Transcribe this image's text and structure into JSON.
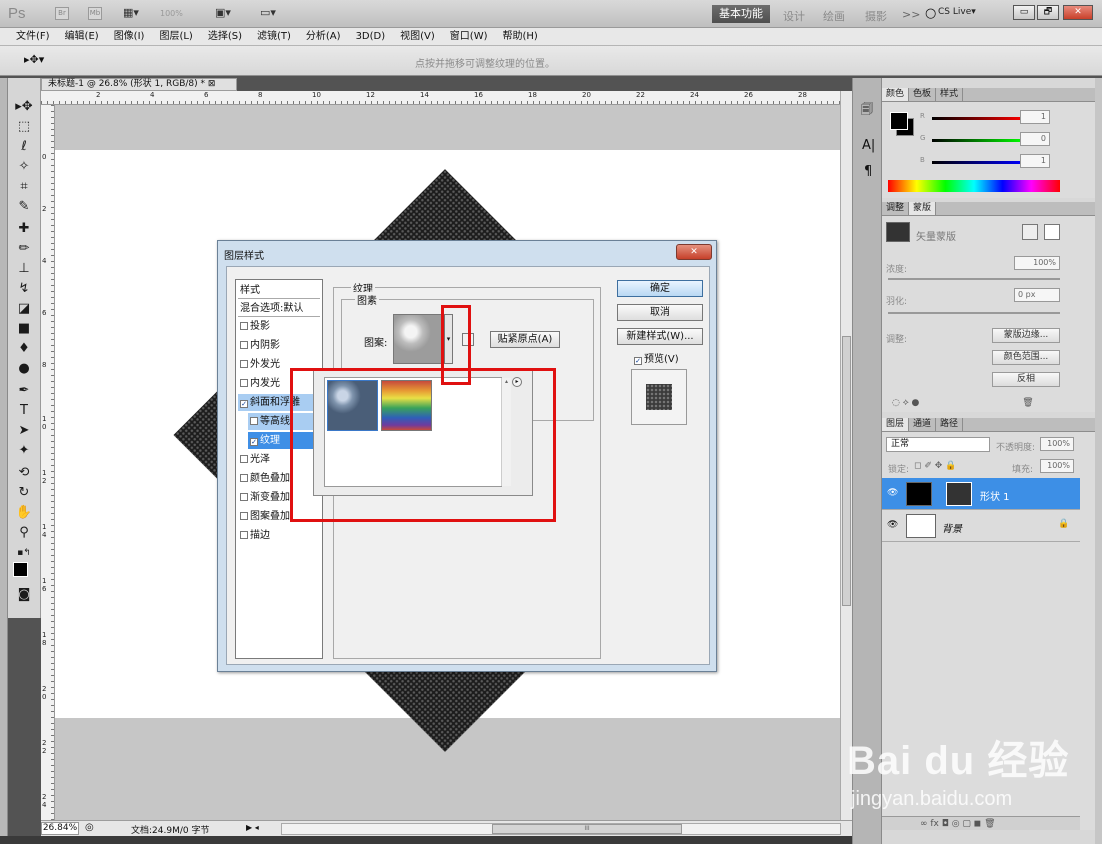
{
  "app": {
    "logo": "Ps",
    "top_icons": [
      "Br",
      "Mb"
    ],
    "zoom_display": "100%",
    "workspace_active": "基本功能",
    "workspaces": [
      "设计",
      "绘画",
      "摄影"
    ],
    "more": ">>",
    "cs_live": "CS Live▾",
    "window_min": "▭",
    "window_max": "🗗",
    "window_close": "✕"
  },
  "menu": {
    "items": [
      "文件(F)",
      "编辑(E)",
      "图像(I)",
      "图层(L)",
      "选择(S)",
      "滤镜(T)",
      "分析(A)",
      "3D(D)",
      "视图(V)",
      "窗口(W)",
      "帮助(H)"
    ]
  },
  "options": {
    "tool": "▸✥▾",
    "hint": "点按并拖移可调整纹理的位置。"
  },
  "document": {
    "tab": "未标题-1 @ 26.8% (形状 1, RGB/8) * ⊠",
    "ruler_top": [
      "2",
      "4",
      "6",
      "8",
      "10",
      "12",
      "14",
      "16",
      "18",
      "20",
      "22",
      "24",
      "26",
      "28"
    ],
    "ruler_left": [
      "0",
      "2",
      "4",
      "6",
      "8",
      "1\n0",
      "1\n2",
      "1\n4",
      "1\n6",
      "1\n8",
      "2\n0",
      "2\n2",
      "2\n4"
    ]
  },
  "status": {
    "zoom": "26.84%",
    "doc_info": "文档:24.9M/0 字节",
    "nav": "▶ ◂",
    "hscroll_mark": "III"
  },
  "dialog": {
    "title": "图层样式",
    "close": "✕",
    "styles": {
      "header": "样式",
      "blend": "混合选项:默认",
      "items": [
        {
          "label": "投影",
          "checked": false
        },
        {
          "label": "内阴影",
          "checked": false
        },
        {
          "label": "外发光",
          "checked": false
        },
        {
          "label": "内发光",
          "checked": false
        },
        {
          "label": "斜面和浮雕",
          "checked": true
        },
        {
          "label": "等高线",
          "checked": false
        },
        {
          "label": "纹理",
          "checked": true
        },
        {
          "label": "光泽",
          "checked": false
        },
        {
          "label": "颜色叠加",
          "checked": false
        },
        {
          "label": "渐变叠加",
          "checked": false
        },
        {
          "label": "图案叠加",
          "checked": false
        },
        {
          "label": "描边",
          "checked": false
        }
      ]
    },
    "texture_group": "纹理",
    "pattern_group": "图素",
    "pattern_label": "图案:",
    "snap_button": "贴紧原点(A)",
    "ok": "确定",
    "cancel": "取消",
    "new_style": "新建样式(W)...",
    "preview": "预览(V)",
    "preview_checked": true
  },
  "right": {
    "dock_icons": [
      "🗐",
      "A|",
      "¶"
    ],
    "color_tabs": [
      "颜色",
      "色板",
      "样式"
    ],
    "channels": [
      {
        "name": "R",
        "value": "1"
      },
      {
        "name": "G",
        "value": "0"
      },
      {
        "name": "B",
        "value": "1"
      }
    ],
    "adjust_tabs": [
      "调整",
      "蒙版"
    ],
    "mask_type": "矢量蒙版",
    "density_label": "浓度:",
    "density_value": "100%",
    "feather_label": "羽化:",
    "feather_value": "0 px",
    "refine_label": "调整:",
    "refine_buttons": [
      "蒙版边缘...",
      "颜色范围...",
      "反相"
    ],
    "layers_tabs": [
      "图层",
      "通道",
      "路径"
    ],
    "blend_mode": "正常",
    "opacity_label": "不透明度:",
    "opacity_value": "100%",
    "lock_label": "锁定:",
    "fill_label": "填充:",
    "fill_value": "100%",
    "layers": [
      {
        "name": "形状 1",
        "selected": true
      },
      {
        "name": "背景",
        "selected": false
      }
    ],
    "footer_icons": "∞ fx ◘ ◎ ▢ ◼ 🗑"
  },
  "watermark": {
    "brand": "Bai du 经验",
    "url": "jingyan.baidu.com"
  },
  "colors": {
    "accent": "#3d8fe6",
    "annotation": "#e01010"
  }
}
